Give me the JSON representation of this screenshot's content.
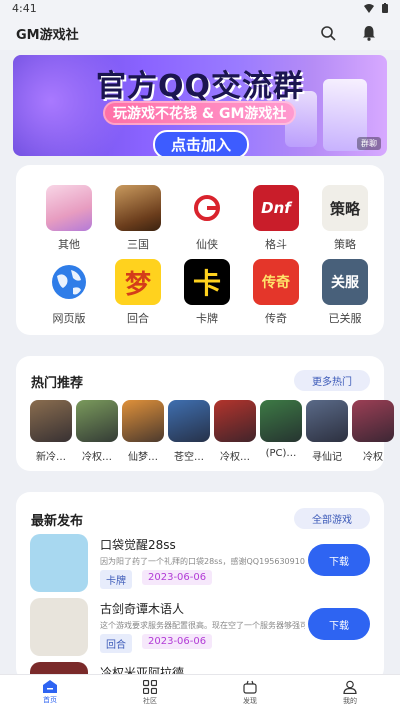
{
  "status": {
    "time": "4:41"
  },
  "app": {
    "title": "GM游戏社"
  },
  "banner": {
    "title": "官方QQ交流群",
    "subtitle": "玩游戏不花钱 & GM游戏社",
    "cta": "点击加入",
    "ad_tag": "群聊"
  },
  "categories": [
    {
      "label": "其他",
      "icon": "anime-girl-icon",
      "color": "#f0a7c3",
      "glyph": ""
    },
    {
      "label": "三国",
      "icon": "warrior-icon",
      "color": "#8a5a2d",
      "glyph": ""
    },
    {
      "label": "仙侠",
      "icon": "xianxia-logo-icon",
      "color": "#ffffff",
      "glyph": ""
    },
    {
      "label": "格斗",
      "icon": "dnf-logo-icon",
      "color": "#c91d2a",
      "glyph": "Dnf"
    },
    {
      "label": "策略",
      "icon": "strategy-text-icon",
      "color": "#f0eee8",
      "glyph": "策略"
    },
    {
      "label": "网页版",
      "icon": "globe-icon",
      "color": "#ffffff",
      "glyph": ""
    },
    {
      "label": "回合",
      "icon": "dream-icon",
      "color": "#ffd21e",
      "glyph": "梦"
    },
    {
      "label": "卡牌",
      "icon": "card-icon",
      "color": "#000000",
      "glyph": "卡"
    },
    {
      "label": "传奇",
      "icon": "legend-icon",
      "color": "#e4362a",
      "glyph": "传奇"
    },
    {
      "label": "已关服",
      "icon": "closed-server-icon",
      "color": "#48607a",
      "glyph": "关服"
    }
  ],
  "hot": {
    "title": "热门推荐",
    "more": "更多热门",
    "items": [
      {
        "label": "新冷…",
        "color": "#8a6d4f"
      },
      {
        "label": "冷权…",
        "color": "#7a9a5c"
      },
      {
        "label": "仙梦…",
        "color": "#e0913a"
      },
      {
        "label": "苍空…",
        "color": "#3f6fb0"
      },
      {
        "label": "冷权…",
        "color": "#b3342c"
      },
      {
        "label": "(PC)…",
        "color": "#3d7a45"
      },
      {
        "label": "寻仙记",
        "color": "#5a6a88"
      },
      {
        "label": "冷权",
        "color": "#9c3f55"
      }
    ]
  },
  "latest": {
    "title": "最新发布",
    "all": "全部游戏",
    "items": [
      {
        "name": "口袋觉醒28ss",
        "desc": "因为阳了药了一个礼拜的口袋28ss，感谢QQ1956309106赞…",
        "tag": "卡牌",
        "date": "2023-06-06",
        "download": "下载",
        "color": "#a8d8f0"
      },
      {
        "name": "古剑奇谭木语人",
        "desc": "这个游戏要求服务器配置很高。现在空了一个服务器够强可…",
        "tag": "回合",
        "date": "2023-06-06",
        "download": "下载",
        "color": "#e8e4dc"
      },
      {
        "name": "冷权米亚阿拉德",
        "desc": "",
        "tag": "",
        "date": "",
        "download": "",
        "color": "#7a2a2a"
      }
    ]
  },
  "nav": [
    {
      "label": "首页",
      "icon": "home-icon",
      "active": true
    },
    {
      "label": "社区",
      "icon": "grid-icon",
      "active": false
    },
    {
      "label": "发现",
      "icon": "discover-icon",
      "active": false
    },
    {
      "label": "我的",
      "icon": "profile-icon",
      "active": false
    }
  ]
}
